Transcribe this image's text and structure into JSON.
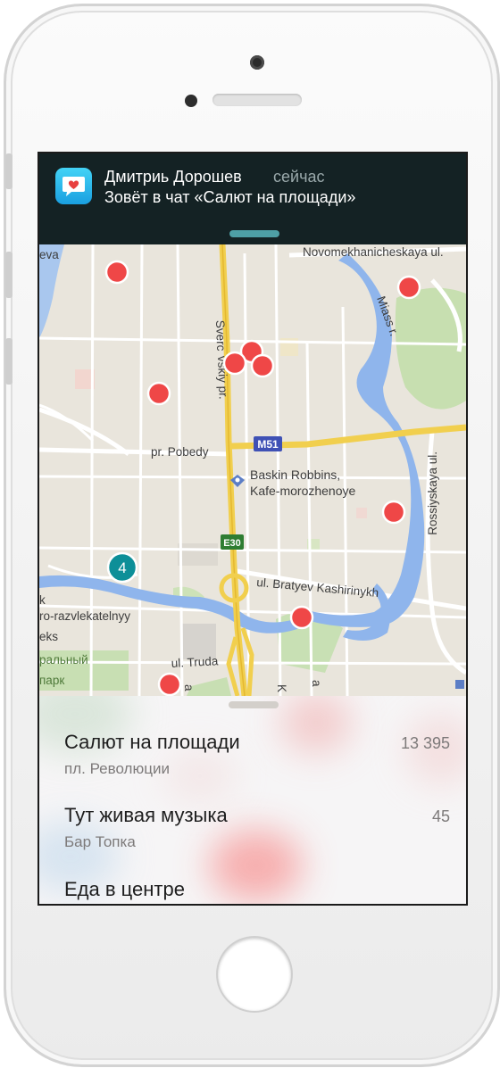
{
  "notification": {
    "sender": "Дмитриь Дорошев",
    "time": "сейчас",
    "message": "Зовёт в чат «Салют на площади»",
    "app_icon": "heart-chat-icon"
  },
  "map": {
    "street_labels": {
      "novomekh": "Novomekhanicheskaya ul.",
      "miass": "Miass r.",
      "sverdlovsky_a": "Sverc",
      "sverdlovsky_b": "vskiy pr.",
      "pobedy": "pr. Pobedy",
      "m51": "M51",
      "rossiyskaya": "Rossiyskaya ul.",
      "e30": "E30",
      "kashirinykh": "ul. Bratyev Kashirinykh",
      "truda": "ul. Truda",
      "eva": "eva",
      "left_k": "k",
      "left_razv": "ro-razvlekatelnyy",
      "left_eks": "eks",
      "park_a": "ральный",
      "park_b": "парк",
      "bottom_a": "a",
      "bottom_k": "K",
      "bottom_a2": "a"
    },
    "poi": {
      "line1": "Baskin Robbins,",
      "line2": "Kafe-morozhenoye"
    },
    "cluster_count": "4"
  },
  "events": [
    {
      "title": "Салют на площади",
      "subtitle": "пл. Революции",
      "count": "13 395"
    },
    {
      "title": "Тут живая музыка",
      "subtitle": "Бар Топка",
      "count": "45"
    },
    {
      "title": "Еда в центре",
      "subtitle": "",
      "count": ""
    }
  ]
}
